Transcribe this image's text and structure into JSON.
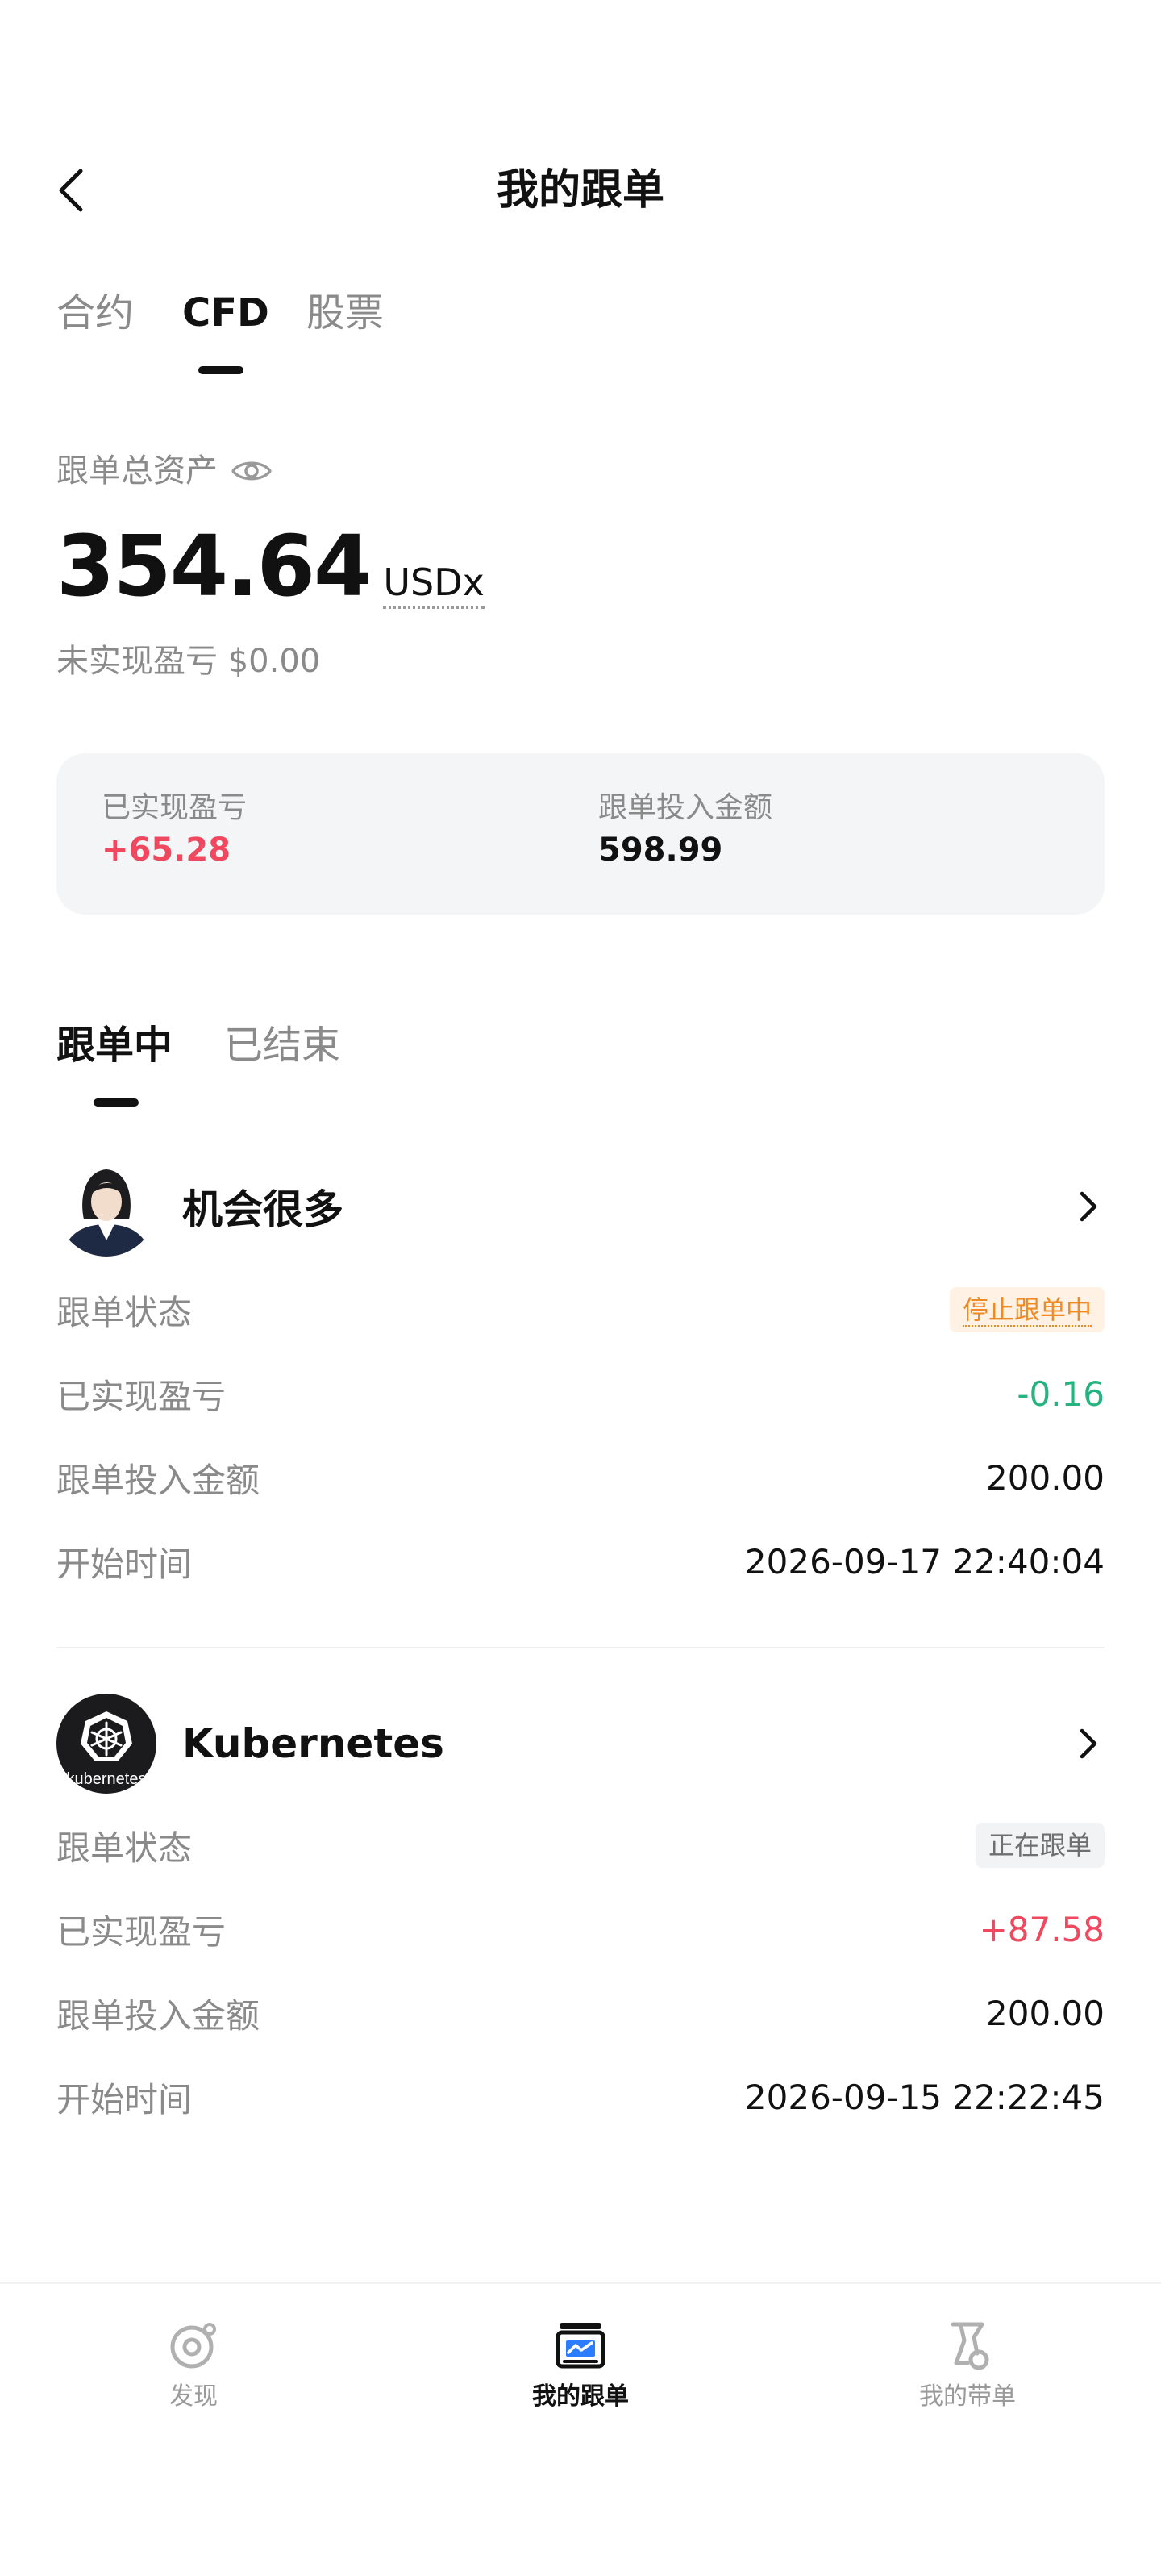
{
  "header": {
    "title": "我的跟单",
    "back_icon": "chevron-left-icon"
  },
  "top_tabs": [
    {
      "label": "合约",
      "active": false
    },
    {
      "label": "CFD",
      "active": true
    },
    {
      "label": "股票",
      "active": false
    }
  ],
  "assets": {
    "label": "跟单总资产",
    "eye_icon": "eye-icon",
    "value": "354.64",
    "unit": "USDx",
    "unrealized_label": "未实现盈亏",
    "unrealized_value": "$0.00"
  },
  "summary": {
    "realized_label": "已实现盈亏",
    "realized_value": "+65.28",
    "invested_label": "跟单投入金额",
    "invested_value": "598.99"
  },
  "status_tabs": [
    {
      "label": "跟单中",
      "active": true
    },
    {
      "label": "已结束",
      "active": false
    }
  ],
  "follows": [
    {
      "trader": "机会很多",
      "status_label": "跟单状态",
      "status": "停止跟单中",
      "pnl_label": "已实现盈亏",
      "pnl": "-0.16",
      "invest_label": "跟单投入金额",
      "invest": "200.00",
      "start_label": "开始时间",
      "start": "2026-09-17 22:40:04"
    },
    {
      "trader": "Kubernetes",
      "avatar_text": "kubernetes",
      "status_label": "跟单状态",
      "status": "正在跟单",
      "pnl_label": "已实现盈亏",
      "pnl": "+87.58",
      "invest_label": "跟单投入金额",
      "invest": "200.00",
      "start_label": "开始时间",
      "start": "2026-09-15 22:22:45"
    }
  ],
  "bottom_nav": [
    {
      "label": "发现",
      "icon": "discover-icon",
      "active": false
    },
    {
      "label": "我的跟单",
      "icon": "my-copy-trades-icon",
      "active": true
    },
    {
      "label": "我的带单",
      "icon": "my-lead-trades-icon",
      "active": false
    }
  ],
  "colors": {
    "profit": "#f0485f",
    "loss": "#27b37f",
    "stopping_badge": "#f08a24",
    "accent": "#111111"
  }
}
